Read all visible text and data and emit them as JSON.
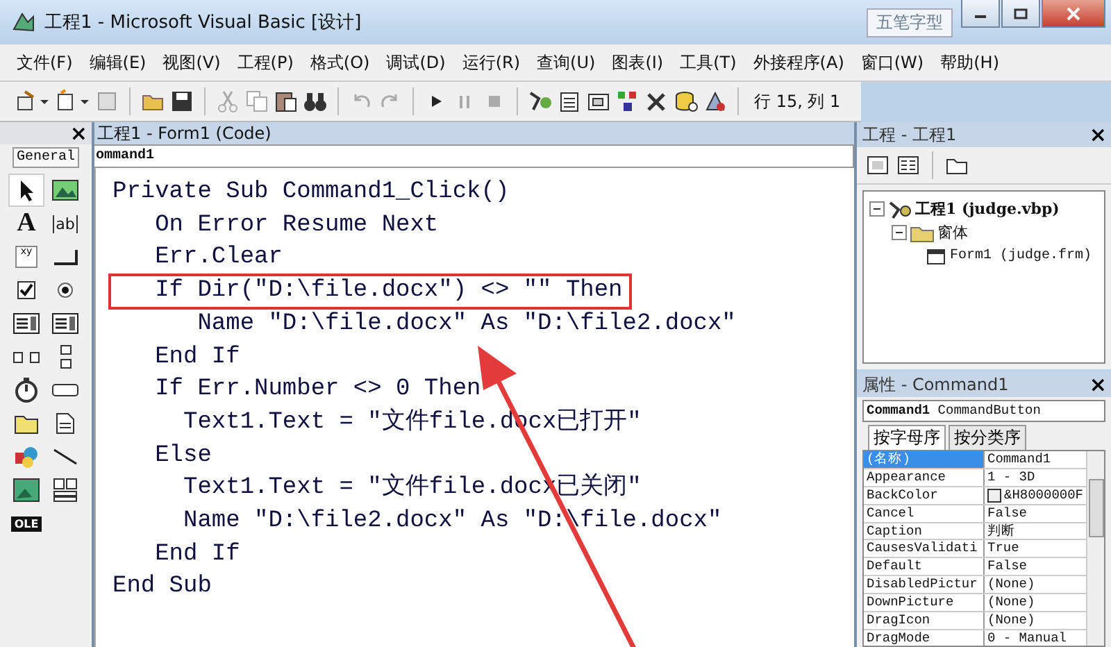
{
  "window": {
    "title": "工程1 - Microsoft Visual Basic [设计]",
    "ime_badge": "五笔字型"
  },
  "menu": [
    "文件(F)",
    "编辑(E)",
    "视图(V)",
    "工程(P)",
    "格式(O)",
    "调试(D)",
    "运行(R)",
    "查询(U)",
    "图表(I)",
    "工具(T)",
    "外接程序(A)",
    "窗口(W)",
    "帮助(H)"
  ],
  "toolbar": {
    "position": "行 15, 列 1"
  },
  "toolbox": {
    "tab": "General",
    "close": "×",
    "tools": [
      {
        "kind": "pointer",
        "selected": true
      },
      {
        "kind": "picture",
        "selected": false
      },
      {
        "kind": "label",
        "glyph": "A",
        "selected": false
      },
      {
        "kind": "textbox",
        "glyph": "ab",
        "selected": false
      },
      {
        "kind": "frame",
        "glyph": "xy",
        "selected": false
      },
      {
        "kind": "command",
        "selected": false
      },
      {
        "kind": "checkbox",
        "selected": false
      },
      {
        "kind": "option",
        "selected": false
      },
      {
        "kind": "combo",
        "selected": false
      },
      {
        "kind": "list",
        "selected": false
      },
      {
        "kind": "hscroll",
        "selected": false
      },
      {
        "kind": "vscroll",
        "selected": false
      },
      {
        "kind": "timer",
        "selected": false
      },
      {
        "kind": "drive",
        "selected": false
      },
      {
        "kind": "dir",
        "selected": false
      },
      {
        "kind": "file",
        "selected": false
      },
      {
        "kind": "shape",
        "selected": false
      },
      {
        "kind": "line",
        "selected": false
      },
      {
        "kind": "image",
        "selected": false
      },
      {
        "kind": "data",
        "selected": false
      },
      {
        "kind": "ole",
        "glyph": "OLE",
        "selected": false
      }
    ]
  },
  "code_window": {
    "title": "工程1 - Form1 (Code)",
    "object": "ommand1",
    "lines": [
      {
        "text": "Private Sub Command1_Click()",
        "highlighted": false
      },
      {
        "text": "   On Error Resume Next",
        "highlighted": false
      },
      {
        "text": "   Err.Clear",
        "highlighted": false
      },
      {
        "text": "   If Dir(\"D:\\file.docx\") <> \"\" Then",
        "highlighted": true
      },
      {
        "text": "      Name \"D:\\file.docx\" As \"D:\\file2.docx\"",
        "highlighted": false
      },
      {
        "text": "   End If",
        "highlighted": false
      },
      {
        "text": "   If Err.Number <> 0 Then",
        "highlighted": false
      },
      {
        "text": "     Text1.Text = \"文件file.docx已打开\"",
        "highlighted": false
      },
      {
        "text": "   Else",
        "highlighted": false
      },
      {
        "text": "     Text1.Text = \"文件file.docx已关闭\"",
        "highlighted": false
      },
      {
        "text": "     Name \"D:\\file2.docx\" As \"D:\\file.docx\"",
        "highlighted": false
      },
      {
        "text": "   End If",
        "highlighted": false
      },
      {
        "text": "End Sub",
        "highlighted": false
      }
    ]
  },
  "project": {
    "title": "工程 - 工程1",
    "close": "×",
    "tree": [
      {
        "label": "工程1 (judge.vbp)",
        "kind": "project",
        "expanded": true,
        "children": [
          {
            "label": "窗体",
            "kind": "folder",
            "expanded": true,
            "children": [
              {
                "label": "Form1 (judge.frm)",
                "kind": "form"
              }
            ]
          }
        ]
      }
    ]
  },
  "properties": {
    "title": "属性 - Command1",
    "close": "×",
    "object": {
      "name": "Command1",
      "type": "CommandButton"
    },
    "tabs": [
      {
        "label": "按字母序",
        "selected": true
      },
      {
        "label": "按分类序",
        "selected": false
      }
    ],
    "rows": [
      {
        "name": "(名称)",
        "value": "Command1",
        "selected": true
      },
      {
        "name": "Appearance",
        "value": "1 - 3D",
        "selected": false
      },
      {
        "name": "BackColor",
        "value": "&H8000000F",
        "color": "#f0f0f0",
        "selected": false
      },
      {
        "name": "Cancel",
        "value": "False",
        "selected": false
      },
      {
        "name": "Caption",
        "value": "判断",
        "selected": false
      },
      {
        "name": "CausesValidati",
        "value": "True",
        "selected": false
      },
      {
        "name": "Default",
        "value": "False",
        "selected": false
      },
      {
        "name": "DisabledPictur",
        "value": "(None)",
        "selected": false
      },
      {
        "name": "DownPicture",
        "value": "(None)",
        "selected": false
      },
      {
        "name": "DragIcon",
        "value": "(None)",
        "selected": false
      },
      {
        "name": "DragMode",
        "value": "0 - Manual",
        "selected": false
      }
    ]
  }
}
